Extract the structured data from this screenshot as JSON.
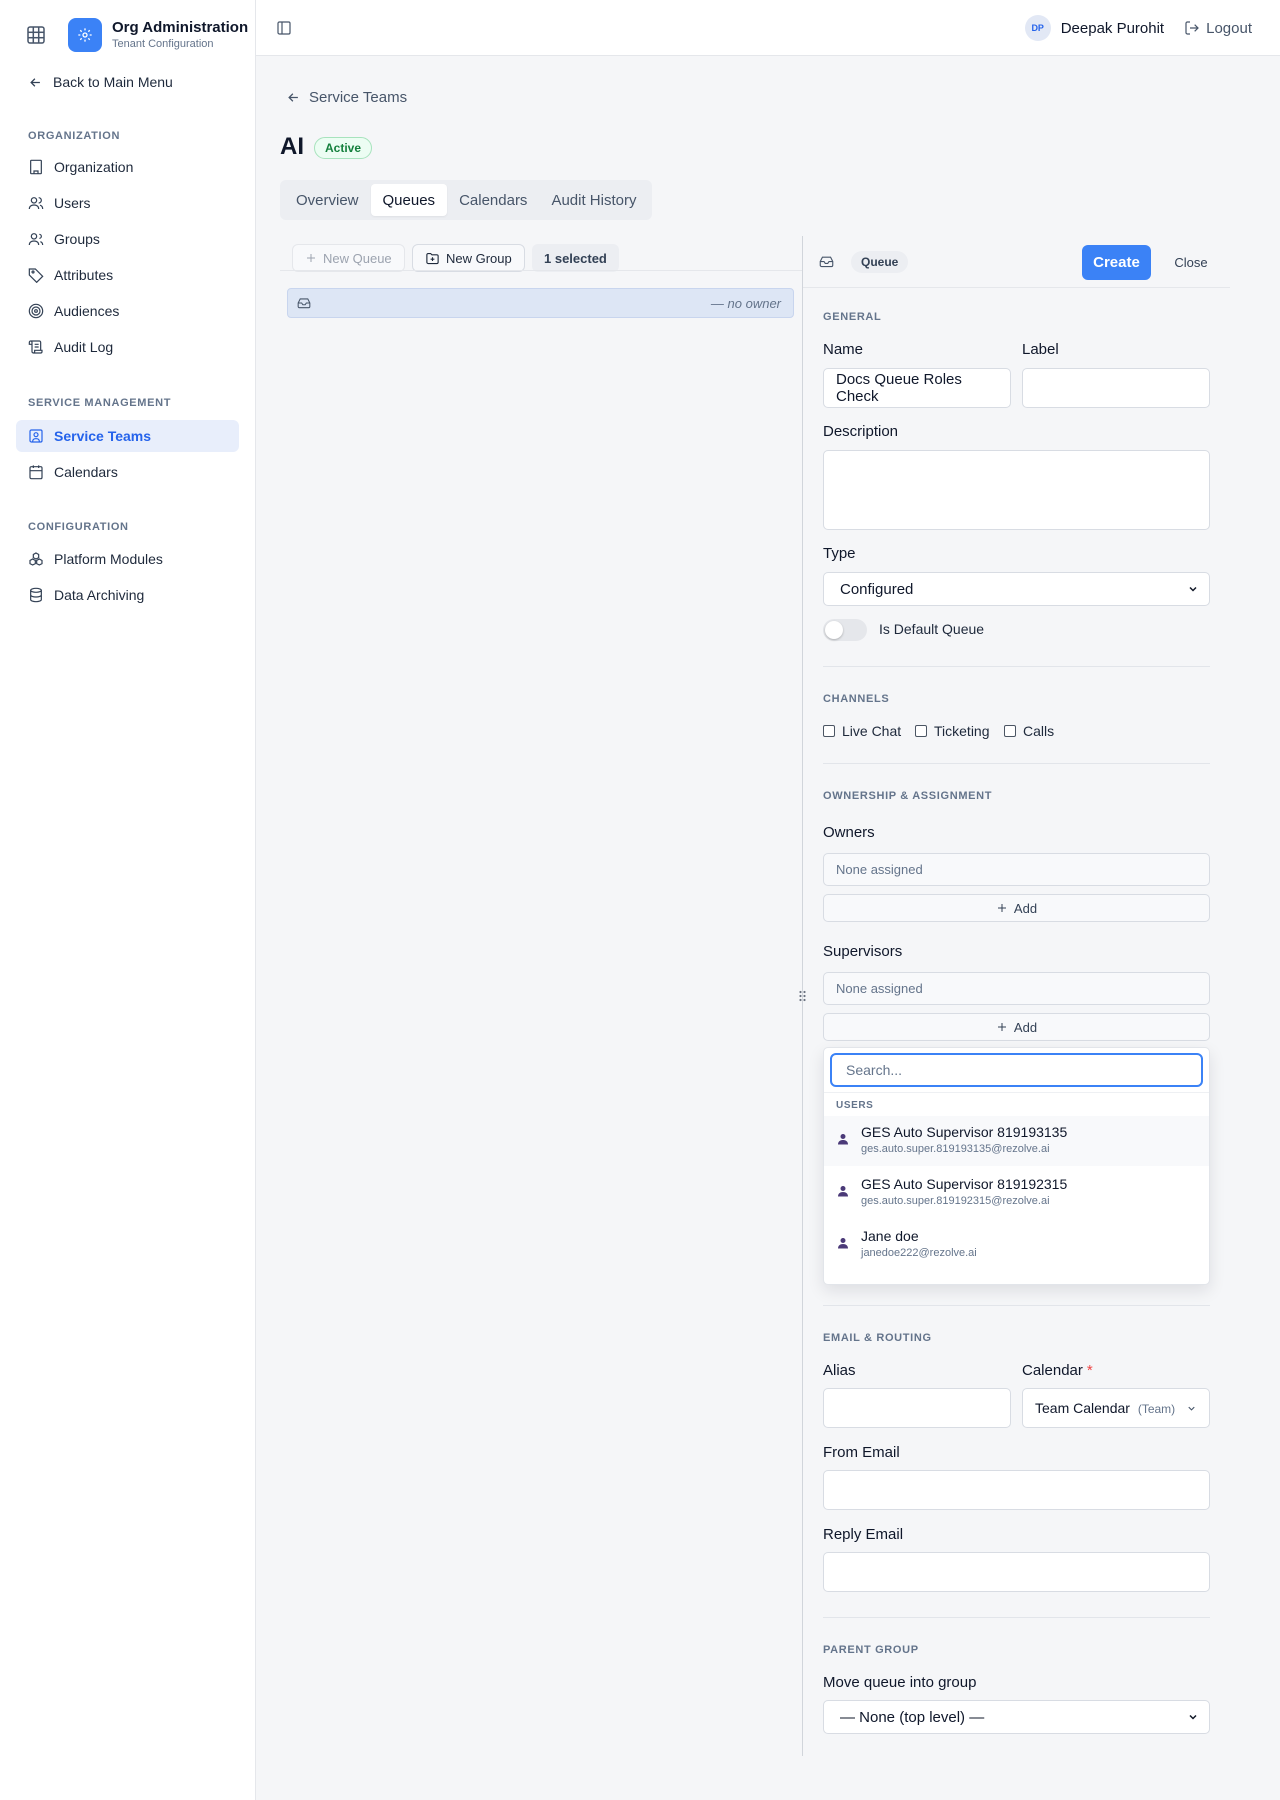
{
  "app": {
    "title": "Org Administration",
    "subtitle": "Tenant Configuration"
  },
  "sidebar": {
    "back_label": "Back to Main Menu",
    "sections": [
      {
        "title": "ORGANIZATION",
        "items": [
          {
            "label": "Organization",
            "icon": "building-icon"
          },
          {
            "label": "Users",
            "icon": "user-icon"
          },
          {
            "label": "Groups",
            "icon": "users-icon"
          },
          {
            "label": "Attributes",
            "icon": "tag-icon"
          },
          {
            "label": "Audiences",
            "icon": "target-icon"
          },
          {
            "label": "Audit Log",
            "icon": "scroll-icon"
          }
        ]
      },
      {
        "title": "SERVICE MANAGEMENT",
        "items": [
          {
            "label": "Service Teams",
            "icon": "contact-icon",
            "active": true
          },
          {
            "label": "Calendars",
            "icon": "calendar-icon"
          }
        ]
      },
      {
        "title": "CONFIGURATION",
        "items": [
          {
            "label": "Platform Modules",
            "icon": "boxes-icon"
          },
          {
            "label": "Data Archiving",
            "icon": "database-icon"
          }
        ]
      }
    ]
  },
  "topbar": {
    "avatar_initials": "DP",
    "user_name": "Deepak Purohit",
    "logout_label": "Logout"
  },
  "page": {
    "breadcrumb": "Service Teams",
    "title": "AI",
    "status": "Active",
    "tabs": [
      {
        "label": "Overview"
      },
      {
        "label": "Queues",
        "active": true
      },
      {
        "label": "Calendars"
      },
      {
        "label": "Audit History"
      }
    ]
  },
  "queues_pane": {
    "new_queue_label": "New Queue",
    "new_group_label": "New Group",
    "selected_label": "1 selected",
    "row_owner": "— no owner"
  },
  "detail_pane": {
    "type_chip": "Queue",
    "create_label": "Create",
    "close_label": "Close",
    "general": {
      "heading": "GENERAL",
      "name_label": "Name",
      "name_value": "Docs Queue Roles Check",
      "label_label": "Label",
      "label_value": "",
      "description_label": "Description",
      "description_value": "",
      "type_label": "Type",
      "type_value": "Configured",
      "default_toggle_label": "Is Default Queue",
      "default_toggle_on": false
    },
    "channels": {
      "heading": "CHANNELS",
      "options": [
        {
          "label": "Live Chat",
          "checked": false
        },
        {
          "label": "Ticketing",
          "checked": false
        },
        {
          "label": "Calls",
          "checked": false
        }
      ]
    },
    "ownership": {
      "heading": "OWNERSHIP & ASSIGNMENT",
      "owners_label": "Owners",
      "owners_empty": "None assigned",
      "supervisors_label": "Supervisors",
      "supervisors_empty": "None assigned",
      "add_label": "Add"
    },
    "picker": {
      "search_placeholder": "Search...",
      "group_label": "USERS",
      "users": [
        {
          "name": "GES Auto Supervisor 819193135",
          "email": "ges.auto.super.819193135@rezolve.ai"
        },
        {
          "name": "GES Auto Supervisor 819192315",
          "email": "ges.auto.super.819192315@rezolve.ai"
        },
        {
          "name": "Jane doe",
          "email": "janedoe222@rezolve.ai"
        }
      ]
    },
    "email_routing": {
      "heading": "EMAIL & ROUTING",
      "alias_label": "Alias",
      "alias_value": "",
      "calendar_label": "Calendar",
      "calendar_value": "Team Calendar",
      "calendar_tag": "(Team)",
      "from_email_label": "From Email",
      "from_email_value": "",
      "reply_email_label": "Reply Email",
      "reply_email_value": ""
    },
    "parent_group": {
      "heading": "PARENT GROUP",
      "move_label": "Move queue into group",
      "move_value": "— None (top level) —"
    }
  },
  "colors": {
    "accent": "#3b82f6",
    "active_nav_bg": "#e8eefb",
    "status_green": "#15803d"
  }
}
